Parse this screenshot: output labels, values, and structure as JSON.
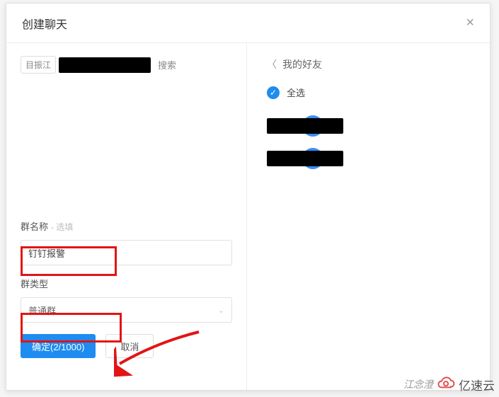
{
  "dialog": {
    "title": "创建聊天",
    "close": "×"
  },
  "search": {
    "chip": "目振江",
    "placeholder": "搜索"
  },
  "group_name": {
    "label": "群名称",
    "hint": "- 选填",
    "value": "钉钉报警"
  },
  "group_type": {
    "label": "群类型",
    "value": "普通群"
  },
  "actions": {
    "confirm": "确定(2/1000)",
    "cancel": "取消"
  },
  "friends": {
    "back_label": "我的好友",
    "select_all": "全选"
  },
  "watermark": {
    "left": "江念澄",
    "right": "亿速云"
  }
}
